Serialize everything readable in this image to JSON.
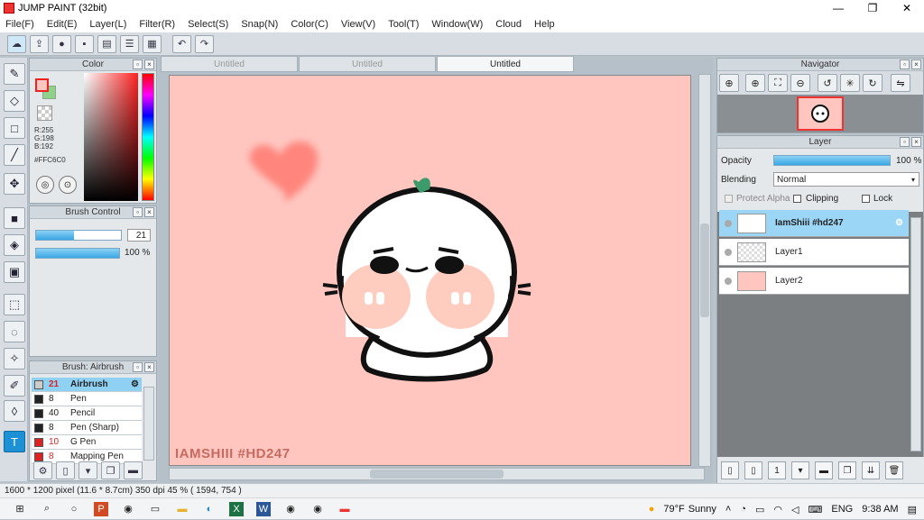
{
  "window": {
    "title": "JUMP PAINT (32bit)",
    "minimize": "—",
    "maximize": "❐",
    "close": "✕"
  },
  "menu": [
    "File(F)",
    "Edit(E)",
    "Layer(L)",
    "Filter(R)",
    "Select(S)",
    "Snap(N)",
    "Color(C)",
    "View(V)",
    "Tool(T)",
    "Window(W)",
    "Cloud",
    "Help"
  ],
  "color_panel": {
    "title": "Color",
    "r": "R:255",
    "g": "G:198",
    "b": "B:192",
    "hex": "#FFC6C0",
    "fg_color": "#FFC6C0",
    "bg_color": "#8FD18A"
  },
  "brush_control": {
    "title": "Brush Control",
    "size": "21",
    "opacity": "100 %",
    "size_fraction": 0.45,
    "opacity_fraction": 1.0
  },
  "brush_list": {
    "title": "Brush: Airbrush",
    "items": [
      {
        "size": "21",
        "name": "Airbrush",
        "color": "#cccccc",
        "selected": true
      },
      {
        "size": "8",
        "name": "Pen",
        "color": "#222222"
      },
      {
        "size": "40",
        "name": "Pencil",
        "color": "#222222"
      },
      {
        "size": "8",
        "name": "Pen (Sharp)",
        "color": "#222222"
      },
      {
        "size": "10",
        "name": "G Pen",
        "color": "#dd2222"
      },
      {
        "size": "8",
        "name": "Mapping Pen",
        "color": "#dd2222"
      }
    ]
  },
  "tabs": [
    {
      "label": "Untitled",
      "active": false
    },
    {
      "label": "Untitled",
      "active": false
    },
    {
      "label": "Untitled",
      "active": true
    }
  ],
  "canvas": {
    "background": "#FFC6C0",
    "watermark": "IAMSHIII #HD247"
  },
  "navigator": {
    "title": "Navigator"
  },
  "layer_panel": {
    "title": "Layer",
    "opacity_label": "Opacity",
    "opacity_value": "100 %",
    "blending_label": "Blending",
    "blending_value": "Normal",
    "protect_alpha": "Protect Alpha",
    "clipping": "Clipping",
    "lock": "Lock",
    "layers": [
      {
        "name": "IamShiii #hd247",
        "selected": true
      },
      {
        "name": "Layer1",
        "selected": false
      },
      {
        "name": "Layer2",
        "selected": false
      }
    ]
  },
  "status": {
    "text": "1600 * 1200 pixel   (11.6 * 8.7cm)   350 dpi   45 %   ( 1594, 754 )"
  },
  "taskbar": {
    "weather_temp": "79°F",
    "weather_text": "Sunny",
    "lang": "ENG",
    "time": "9:38 AM"
  }
}
